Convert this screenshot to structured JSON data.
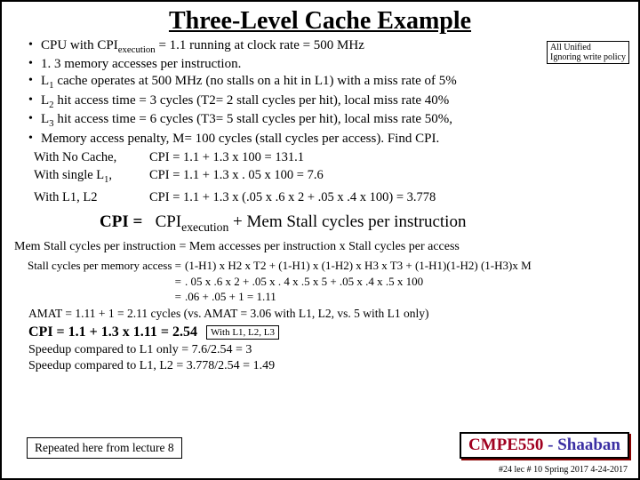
{
  "title": "Three-Level Cache Example",
  "corner_note": {
    "l1": "All Unified",
    "l2": "Ignoring write policy"
  },
  "bullets": [
    "CPU with CPI<span class='sub'>execution</span> = 1.1  running at clock rate = 500 MHz",
    "1. 3 memory accesses per instruction.",
    "L<span class='sub'>1</span> cache operates at 500 MHz (no stalls on a hit in L1) with a miss rate of 5%",
    "L<span class='sub'>2</span> hit access time = 3 cycles (T2= 2 stall cycles per hit),  local miss rate  40%",
    "L<span class='sub'>3</span> hit access time = 6 cycles (T3= 5 stall cycles per hit), local miss rate 50%,",
    "Memory access penalty,  M= 100 cycles  (stall cycles per access).    Find CPI."
  ],
  "calc": [
    {
      "label": "With No Cache,",
      "expr": "CPI  =  1.1 +  1.3 x 100  =  131.1"
    },
    {
      "label": "With single L<span class='sub'>1</span>,",
      "expr": "CPI  =  1.1  +  1.3 x . 05 x 100 =  7.6"
    },
    {
      "label": "With L1,  L2",
      "expr": "CPI  =  1.1  +  1.3 x  (.05 x  .6 x 2  +  .05 x  .4  x  100)  = 3.778"
    }
  ],
  "main_eq_left": "CPI =",
  "main_eq_right": "CPI<span class='sub'>execution</span>  +    Mem Stall  cycles per instruction",
  "mem_stall": "Mem Stall cycles per instruction =  Mem accesses per instruction  x  Stall cycles per access",
  "spma": [
    {
      "l": "Stall cycles per memory access    =",
      "r": "(1-H1) x H2 x T2 +  (1-H1) x (1-H2) x H3 x T3   + (1-H1)(1-H2) (1-H3)x M"
    },
    {
      "l": "=",
      "r": ". 05 x  .6  x  2   +  .05 x . 4  x  .5 x  5  +  .05 x  .4 x  .5  x  100"
    },
    {
      "l": "=",
      "r": ".06 +   .05     +    1    =     1.11"
    }
  ],
  "amat": "AMAT = 1.11 + 1 = 2.11 cycles  (vs.  AMAT = 3.06 with L1, L2,  vs.  5  with L1 only)",
  "final_cpi": "CPI = 1.1 +  1.3 x 1.11   =   2.54",
  "with_box": "With L1, L2, L3",
  "speedups": [
    "Speedup compared to L1 only =  7.6/2.54  =   3",
    "Speedup compared to L1, L2  =  3.778/2.54  =  1.49"
  ],
  "rep_box": "Repeated here from lecture 8",
  "course": {
    "a": "CMPE550",
    "b": " - Shaaban"
  },
  "footer": "#24   lec # 10   Spring 2017   4-24-2017"
}
